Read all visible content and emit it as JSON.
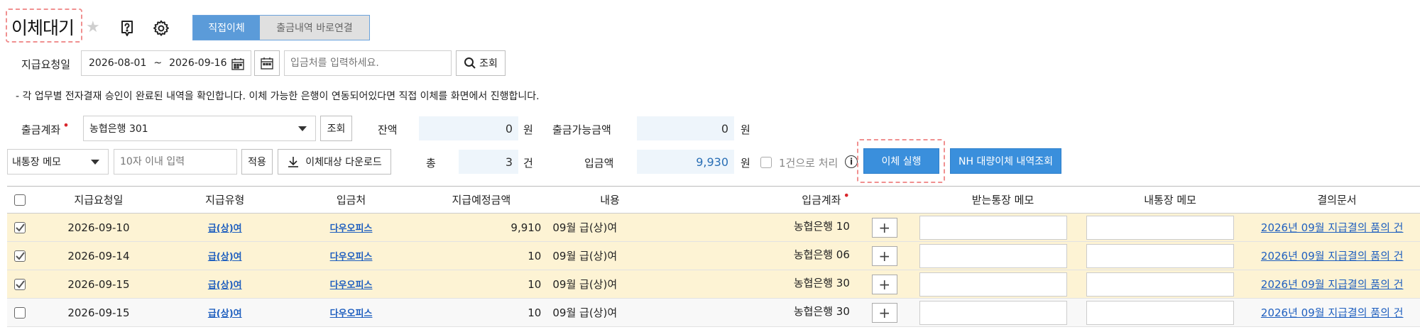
{
  "header": {
    "title": "이체대기",
    "tabs": [
      {
        "label": "직접이체",
        "active": true
      },
      {
        "label": "출금내역 바로연결",
        "active": false
      }
    ]
  },
  "search": {
    "date_label": "지급요청일",
    "date_from": "2026-08-01",
    "date_sep": "~",
    "date_to": "2026-09-16",
    "payee_placeholder": "입금처를 입력하세요.",
    "search_button": "조회"
  },
  "notice": "- 각 업무별 전자결재 승인이 완료된 내역을 확인합니다. 이체 가능한 은행이 연동되어있다면 직접 이체를 화면에서 진행합니다.",
  "account": {
    "label": "출금계좌",
    "selected": "농협은행 301",
    "query_button": "조회",
    "balance_label": "잔액",
    "balance_value": "0",
    "balance_unit": "원",
    "available_label": "출금가능금액",
    "available_value": "0",
    "available_unit": "원"
  },
  "memo_row": {
    "memo_select": "내통장 메모",
    "memo_placeholder": "10자 이내 입력",
    "apply_button": "적용",
    "download_button": "이체대상 다운로드",
    "total_label": "총",
    "total_value": "3",
    "total_unit": "건",
    "deposit_label": "입금액",
    "deposit_value": "9,930",
    "deposit_unit": "원",
    "single_label": "1건으로 처리",
    "execute_button": "이체 실행",
    "nh_button": "NH 대량이체 내역조회"
  },
  "table": {
    "headers": [
      "지급요청일",
      "지급유형",
      "입금처",
      "지급예정금액",
      "내용",
      "입금계좌",
      "받는통장 메모",
      "내통장 메모",
      "결의문서"
    ],
    "rows": [
      {
        "checked": true,
        "date": "2026-09-10",
        "type": "급(상)여",
        "payee": "다우오피스",
        "amount": "9,910",
        "content": "09월 급(상)여",
        "account": "농협은행 10",
        "doc": "2026년 09월 지급결의 품의 건"
      },
      {
        "checked": true,
        "date": "2026-09-14",
        "type": "급(상)여",
        "payee": "다우오피스",
        "amount": "10",
        "content": "09월 급(상)여",
        "account": "농협은행 06",
        "doc": "2026년 09월 지급결의 품의 건"
      },
      {
        "checked": true,
        "date": "2026-09-15",
        "type": "급(상)여",
        "payee": "다우오피스",
        "amount": "10",
        "content": "09월 급(상)여",
        "account": "농협은행 30",
        "doc": "2026년 09월 지급결의 품의 건"
      },
      {
        "checked": false,
        "date": "2026-09-15",
        "type": "급(상)여",
        "payee": "다우오피스",
        "amount": "10",
        "content": "09월 급(상)여",
        "account": "농협은행 30",
        "doc": "2026년 09월 지급결의 품의 건"
      }
    ]
  },
  "colors": {
    "accent": "#3a8fdc",
    "selected_row": "#fdf3d4",
    "link": "#1f5fbf",
    "required_dot": "#d9262c"
  }
}
